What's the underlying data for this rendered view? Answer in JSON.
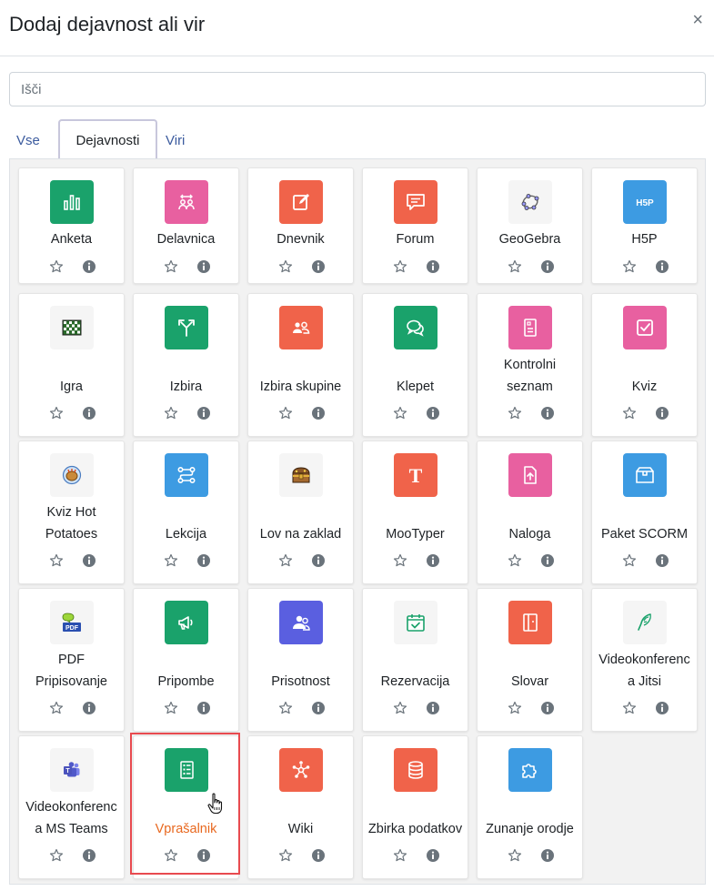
{
  "modal": {
    "title": "Dodaj dejavnost ali vir",
    "close_glyph": "×"
  },
  "search": {
    "value": "",
    "placeholder": "Išči"
  },
  "tabs": [
    {
      "label": "Vse",
      "active": false
    },
    {
      "label": "Dejavnosti",
      "active": true
    },
    {
      "label": "Viri",
      "active": false
    }
  ],
  "highlighted_item": "Vprašalnik",
  "items": [
    {
      "label": "Anketa",
      "icon": "bar-chart-icon",
      "color": "#1aa26b"
    },
    {
      "label": "Delavnica",
      "icon": "workshop-icon",
      "color": "#e860a0"
    },
    {
      "label": "Dnevnik",
      "icon": "journal-edit-icon",
      "color": "#f0634a"
    },
    {
      "label": "Forum",
      "icon": "forum-icon",
      "color": "#f0634a"
    },
    {
      "label": "GeoGebra",
      "icon": "geogebra-icon",
      "color": "#f5f5f5"
    },
    {
      "label": "H5P",
      "icon": "h5p-icon",
      "color": "#3d9be2"
    },
    {
      "label": "Igra",
      "icon": "game-board-icon",
      "color": "#f5f5f5"
    },
    {
      "label": "Izbira",
      "icon": "choice-icon",
      "color": "#1aa26b"
    },
    {
      "label": "Izbira skupine",
      "icon": "group-choice-icon",
      "color": "#f0634a"
    },
    {
      "label": "Klepet",
      "icon": "chat-icon",
      "color": "#1aa26b"
    },
    {
      "label": "Kontrolni seznam",
      "icon": "checklist-icon",
      "color": "#e860a0"
    },
    {
      "label": "Kviz",
      "icon": "quiz-icon",
      "color": "#e860a0"
    },
    {
      "label": "Kviz Hot Potatoes",
      "icon": "hot-potatoes-icon",
      "color": "#f5f5f5"
    },
    {
      "label": "Lekcija",
      "icon": "lesson-icon",
      "color": "#3d9be2"
    },
    {
      "label": "Lov na zaklad",
      "icon": "treasure-chest-icon",
      "color": "#f5f5f5"
    },
    {
      "label": "MooTyper",
      "icon": "mootyper-icon",
      "color": "#f0634a"
    },
    {
      "label": "Naloga",
      "icon": "assignment-icon",
      "color": "#e860a0"
    },
    {
      "label": "Paket SCORM",
      "icon": "scorm-package-icon",
      "color": "#3d9be2"
    },
    {
      "label": "PDF Pripisovanje",
      "icon": "pdf-annotation-icon",
      "color": "#f5f5f5"
    },
    {
      "label": "Pripombe",
      "icon": "feedback-megaphone-icon",
      "color": "#1aa26b"
    },
    {
      "label": "Prisotnost",
      "icon": "attendance-icon",
      "color": "#5a5fe0"
    },
    {
      "label": "Rezervacija",
      "icon": "calendar-check-icon",
      "color": "#f5f5f5"
    },
    {
      "label": "Slovar",
      "icon": "glossary-icon",
      "color": "#f0634a"
    },
    {
      "label": "Videokonferenca Jitsi",
      "icon": "jitsi-feather-icon",
      "color": "#f5f5f5"
    },
    {
      "label": "Videokonferenca MS Teams",
      "icon": "ms-teams-icon",
      "color": "#f5f5f5"
    },
    {
      "label": "Vprašalnik",
      "icon": "questionnaire-icon",
      "color": "#1aa26b"
    },
    {
      "label": "Wiki",
      "icon": "wiki-icon",
      "color": "#f0634a"
    },
    {
      "label": "Zbirka podatkov",
      "icon": "database-icon",
      "color": "#f0634a"
    },
    {
      "label": "Zunanje orodje",
      "icon": "puzzle-icon",
      "color": "#3d9be2"
    }
  ]
}
